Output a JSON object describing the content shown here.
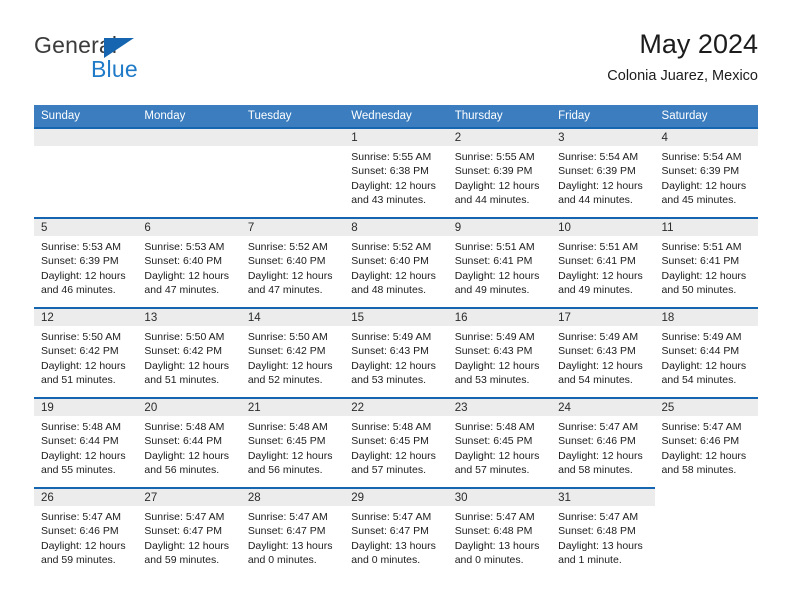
{
  "brand": {
    "name_part1": "General",
    "name_part2": "Blue",
    "triangle_icon": "blue-triangle-icon",
    "color_dark": "#3b3b3b",
    "color_blue": "#1f7bc8"
  },
  "header": {
    "title": "May 2024",
    "subtitle": "Colonia Juarez, Mexico"
  },
  "theme": {
    "header_bg": "#3b7dbf",
    "row_border": "#1565b0",
    "daynum_bg": "#ececec",
    "text": "#1c1c1c"
  },
  "calendar": {
    "weekday_headers": [
      "Sunday",
      "Monday",
      "Tuesday",
      "Wednesday",
      "Thursday",
      "Friday",
      "Saturday"
    ],
    "weeks": [
      [
        {
          "day": "",
          "empty": true
        },
        {
          "day": "",
          "empty": true
        },
        {
          "day": "",
          "empty": true
        },
        {
          "day": "1",
          "sunrise": "Sunrise: 5:55 AM",
          "sunset": "Sunset: 6:38 PM",
          "daylight_1": "Daylight: 12 hours",
          "daylight_2": "and 43 minutes."
        },
        {
          "day": "2",
          "sunrise": "Sunrise: 5:55 AM",
          "sunset": "Sunset: 6:39 PM",
          "daylight_1": "Daylight: 12 hours",
          "daylight_2": "and 44 minutes."
        },
        {
          "day": "3",
          "sunrise": "Sunrise: 5:54 AM",
          "sunset": "Sunset: 6:39 PM",
          "daylight_1": "Daylight: 12 hours",
          "daylight_2": "and 44 minutes."
        },
        {
          "day": "4",
          "sunrise": "Sunrise: 5:54 AM",
          "sunset": "Sunset: 6:39 PM",
          "daylight_1": "Daylight: 12 hours",
          "daylight_2": "and 45 minutes."
        }
      ],
      [
        {
          "day": "5",
          "sunrise": "Sunrise: 5:53 AM",
          "sunset": "Sunset: 6:39 PM",
          "daylight_1": "Daylight: 12 hours",
          "daylight_2": "and 46 minutes."
        },
        {
          "day": "6",
          "sunrise": "Sunrise: 5:53 AM",
          "sunset": "Sunset: 6:40 PM",
          "daylight_1": "Daylight: 12 hours",
          "daylight_2": "and 47 minutes."
        },
        {
          "day": "7",
          "sunrise": "Sunrise: 5:52 AM",
          "sunset": "Sunset: 6:40 PM",
          "daylight_1": "Daylight: 12 hours",
          "daylight_2": "and 47 minutes."
        },
        {
          "day": "8",
          "sunrise": "Sunrise: 5:52 AM",
          "sunset": "Sunset: 6:40 PM",
          "daylight_1": "Daylight: 12 hours",
          "daylight_2": "and 48 minutes."
        },
        {
          "day": "9",
          "sunrise": "Sunrise: 5:51 AM",
          "sunset": "Sunset: 6:41 PM",
          "daylight_1": "Daylight: 12 hours",
          "daylight_2": "and 49 minutes."
        },
        {
          "day": "10",
          "sunrise": "Sunrise: 5:51 AM",
          "sunset": "Sunset: 6:41 PM",
          "daylight_1": "Daylight: 12 hours",
          "daylight_2": "and 49 minutes."
        },
        {
          "day": "11",
          "sunrise": "Sunrise: 5:51 AM",
          "sunset": "Sunset: 6:41 PM",
          "daylight_1": "Daylight: 12 hours",
          "daylight_2": "and 50 minutes."
        }
      ],
      [
        {
          "day": "12",
          "sunrise": "Sunrise: 5:50 AM",
          "sunset": "Sunset: 6:42 PM",
          "daylight_1": "Daylight: 12 hours",
          "daylight_2": "and 51 minutes."
        },
        {
          "day": "13",
          "sunrise": "Sunrise: 5:50 AM",
          "sunset": "Sunset: 6:42 PM",
          "daylight_1": "Daylight: 12 hours",
          "daylight_2": "and 51 minutes."
        },
        {
          "day": "14",
          "sunrise": "Sunrise: 5:50 AM",
          "sunset": "Sunset: 6:42 PM",
          "daylight_1": "Daylight: 12 hours",
          "daylight_2": "and 52 minutes."
        },
        {
          "day": "15",
          "sunrise": "Sunrise: 5:49 AM",
          "sunset": "Sunset: 6:43 PM",
          "daylight_1": "Daylight: 12 hours",
          "daylight_2": "and 53 minutes."
        },
        {
          "day": "16",
          "sunrise": "Sunrise: 5:49 AM",
          "sunset": "Sunset: 6:43 PM",
          "daylight_1": "Daylight: 12 hours",
          "daylight_2": "and 53 minutes."
        },
        {
          "day": "17",
          "sunrise": "Sunrise: 5:49 AM",
          "sunset": "Sunset: 6:43 PM",
          "daylight_1": "Daylight: 12 hours",
          "daylight_2": "and 54 minutes."
        },
        {
          "day": "18",
          "sunrise": "Sunrise: 5:49 AM",
          "sunset": "Sunset: 6:44 PM",
          "daylight_1": "Daylight: 12 hours",
          "daylight_2": "and 54 minutes."
        }
      ],
      [
        {
          "day": "19",
          "sunrise": "Sunrise: 5:48 AM",
          "sunset": "Sunset: 6:44 PM",
          "daylight_1": "Daylight: 12 hours",
          "daylight_2": "and 55 minutes."
        },
        {
          "day": "20",
          "sunrise": "Sunrise: 5:48 AM",
          "sunset": "Sunset: 6:44 PM",
          "daylight_1": "Daylight: 12 hours",
          "daylight_2": "and 56 minutes."
        },
        {
          "day": "21",
          "sunrise": "Sunrise: 5:48 AM",
          "sunset": "Sunset: 6:45 PM",
          "daylight_1": "Daylight: 12 hours",
          "daylight_2": "and 56 minutes."
        },
        {
          "day": "22",
          "sunrise": "Sunrise: 5:48 AM",
          "sunset": "Sunset: 6:45 PM",
          "daylight_1": "Daylight: 12 hours",
          "daylight_2": "and 57 minutes."
        },
        {
          "day": "23",
          "sunrise": "Sunrise: 5:48 AM",
          "sunset": "Sunset: 6:45 PM",
          "daylight_1": "Daylight: 12 hours",
          "daylight_2": "and 57 minutes."
        },
        {
          "day": "24",
          "sunrise": "Sunrise: 5:47 AM",
          "sunset": "Sunset: 6:46 PM",
          "daylight_1": "Daylight: 12 hours",
          "daylight_2": "and 58 minutes."
        },
        {
          "day": "25",
          "sunrise": "Sunrise: 5:47 AM",
          "sunset": "Sunset: 6:46 PM",
          "daylight_1": "Daylight: 12 hours",
          "daylight_2": "and 58 minutes."
        }
      ],
      [
        {
          "day": "26",
          "sunrise": "Sunrise: 5:47 AM",
          "sunset": "Sunset: 6:46 PM",
          "daylight_1": "Daylight: 12 hours",
          "daylight_2": "and 59 minutes."
        },
        {
          "day": "27",
          "sunrise": "Sunrise: 5:47 AM",
          "sunset": "Sunset: 6:47 PM",
          "daylight_1": "Daylight: 12 hours",
          "daylight_2": "and 59 minutes."
        },
        {
          "day": "28",
          "sunrise": "Sunrise: 5:47 AM",
          "sunset": "Sunset: 6:47 PM",
          "daylight_1": "Daylight: 13 hours",
          "daylight_2": "and 0 minutes."
        },
        {
          "day": "29",
          "sunrise": "Sunrise: 5:47 AM",
          "sunset": "Sunset: 6:47 PM",
          "daylight_1": "Daylight: 13 hours",
          "daylight_2": "and 0 minutes."
        },
        {
          "day": "30",
          "sunrise": "Sunrise: 5:47 AM",
          "sunset": "Sunset: 6:48 PM",
          "daylight_1": "Daylight: 13 hours",
          "daylight_2": "and 0 minutes."
        },
        {
          "day": "31",
          "sunrise": "Sunrise: 5:47 AM",
          "sunset": "Sunset: 6:48 PM",
          "daylight_1": "Daylight: 13 hours",
          "daylight_2": "and 1 minute."
        },
        {
          "day": "",
          "empty": true,
          "blank_cell": true
        }
      ]
    ]
  }
}
